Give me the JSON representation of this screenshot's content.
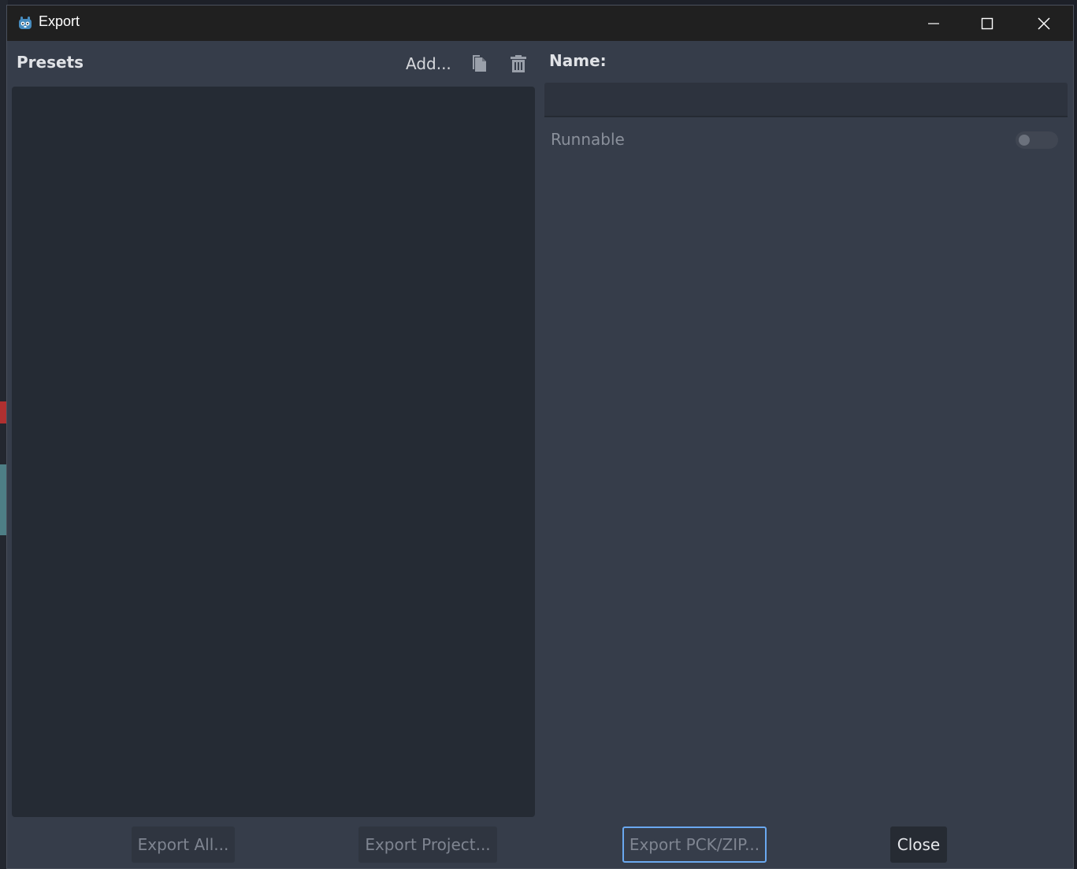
{
  "window": {
    "title": "Export",
    "icon": "godot-icon",
    "controls": [
      "minimize-icon",
      "maximize-icon",
      "close-icon"
    ]
  },
  "presets": {
    "label": "Presets",
    "add_label": "Add...",
    "duplicate_icon": "duplicate-icon",
    "delete_icon": "trash-icon",
    "items": []
  },
  "details": {
    "name_label": "Name:",
    "name_value": "",
    "runnable_label": "Runnable",
    "runnable_enabled": false
  },
  "footer": {
    "export_all_label": "Export All...",
    "export_project_label": "Export Project...",
    "export_pck_label": "Export PCK/ZIP...",
    "close_label": "Close"
  },
  "colors": {
    "accent": "#6aa8ef",
    "panel": "#363d4a",
    "list_bg": "#252b34",
    "titlebar": "#202020"
  }
}
